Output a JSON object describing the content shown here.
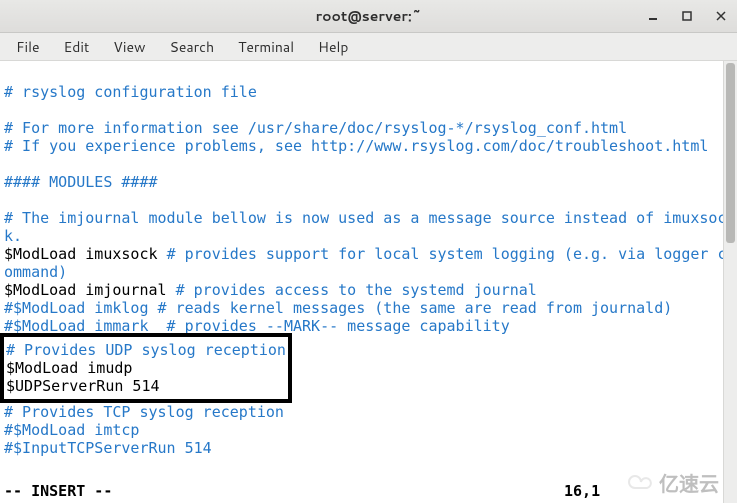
{
  "window": {
    "title": "root@server:~",
    "controls": {
      "minimize": "–",
      "maximize": "□",
      "close": "×"
    }
  },
  "menubar": {
    "items": [
      "File",
      "Edit",
      "View",
      "Search",
      "Terminal",
      "Help"
    ]
  },
  "editor": {
    "lines": [
      {
        "cls": "comment",
        "text": "# rsyslog configuration file"
      },
      {
        "cls": "blank",
        "text": ""
      },
      {
        "cls": "comment",
        "text": "# For more information see /usr/share/doc/rsyslog-*/rsyslog_conf.html"
      },
      {
        "cls": "comment",
        "text": "# If you experience problems, see http://www.rsyslog.com/doc/troubleshoot.html"
      },
      {
        "cls": "blank",
        "text": ""
      },
      {
        "cls": "comment",
        "text": "#### MODULES ####"
      },
      {
        "cls": "blank",
        "text": ""
      },
      {
        "cls": "comment",
        "text": "# The imjournal module bellow is now used as a message source instead of imuxsoc"
      },
      {
        "cls": "comment",
        "text": "k."
      },
      {
        "cls": "mixed",
        "pre": "$ModLoad imuxsock ",
        "post": "# provides support for local system logging (e.g. via logger c"
      },
      {
        "cls": "comment",
        "text": "ommand)"
      },
      {
        "cls": "mixed",
        "pre": "$ModLoad imjournal ",
        "post": "# provides access to the systemd journal"
      },
      {
        "cls": "comment",
        "text": "#$ModLoad imklog # reads kernel messages (the same are read from journald)"
      },
      {
        "cls": "comment",
        "text": "#$ModLoad immark  # provides --MARK-- message capability"
      }
    ],
    "highlight": {
      "line1": "# Provides UDP syslog reception",
      "line2": "$ModLoad imudp",
      "line3": "$UDPServerRun 514"
    },
    "after": [
      {
        "cls": "comment",
        "text": "# Provides TCP syslog reception"
      },
      {
        "cls": "comment",
        "text": "#$ModLoad imtcp"
      },
      {
        "cls": "comment",
        "text": "#$InputTCPServerRun 514"
      }
    ],
    "status": {
      "mode": "-- INSERT --",
      "position": "16,1"
    }
  },
  "watermark": "亿速云"
}
